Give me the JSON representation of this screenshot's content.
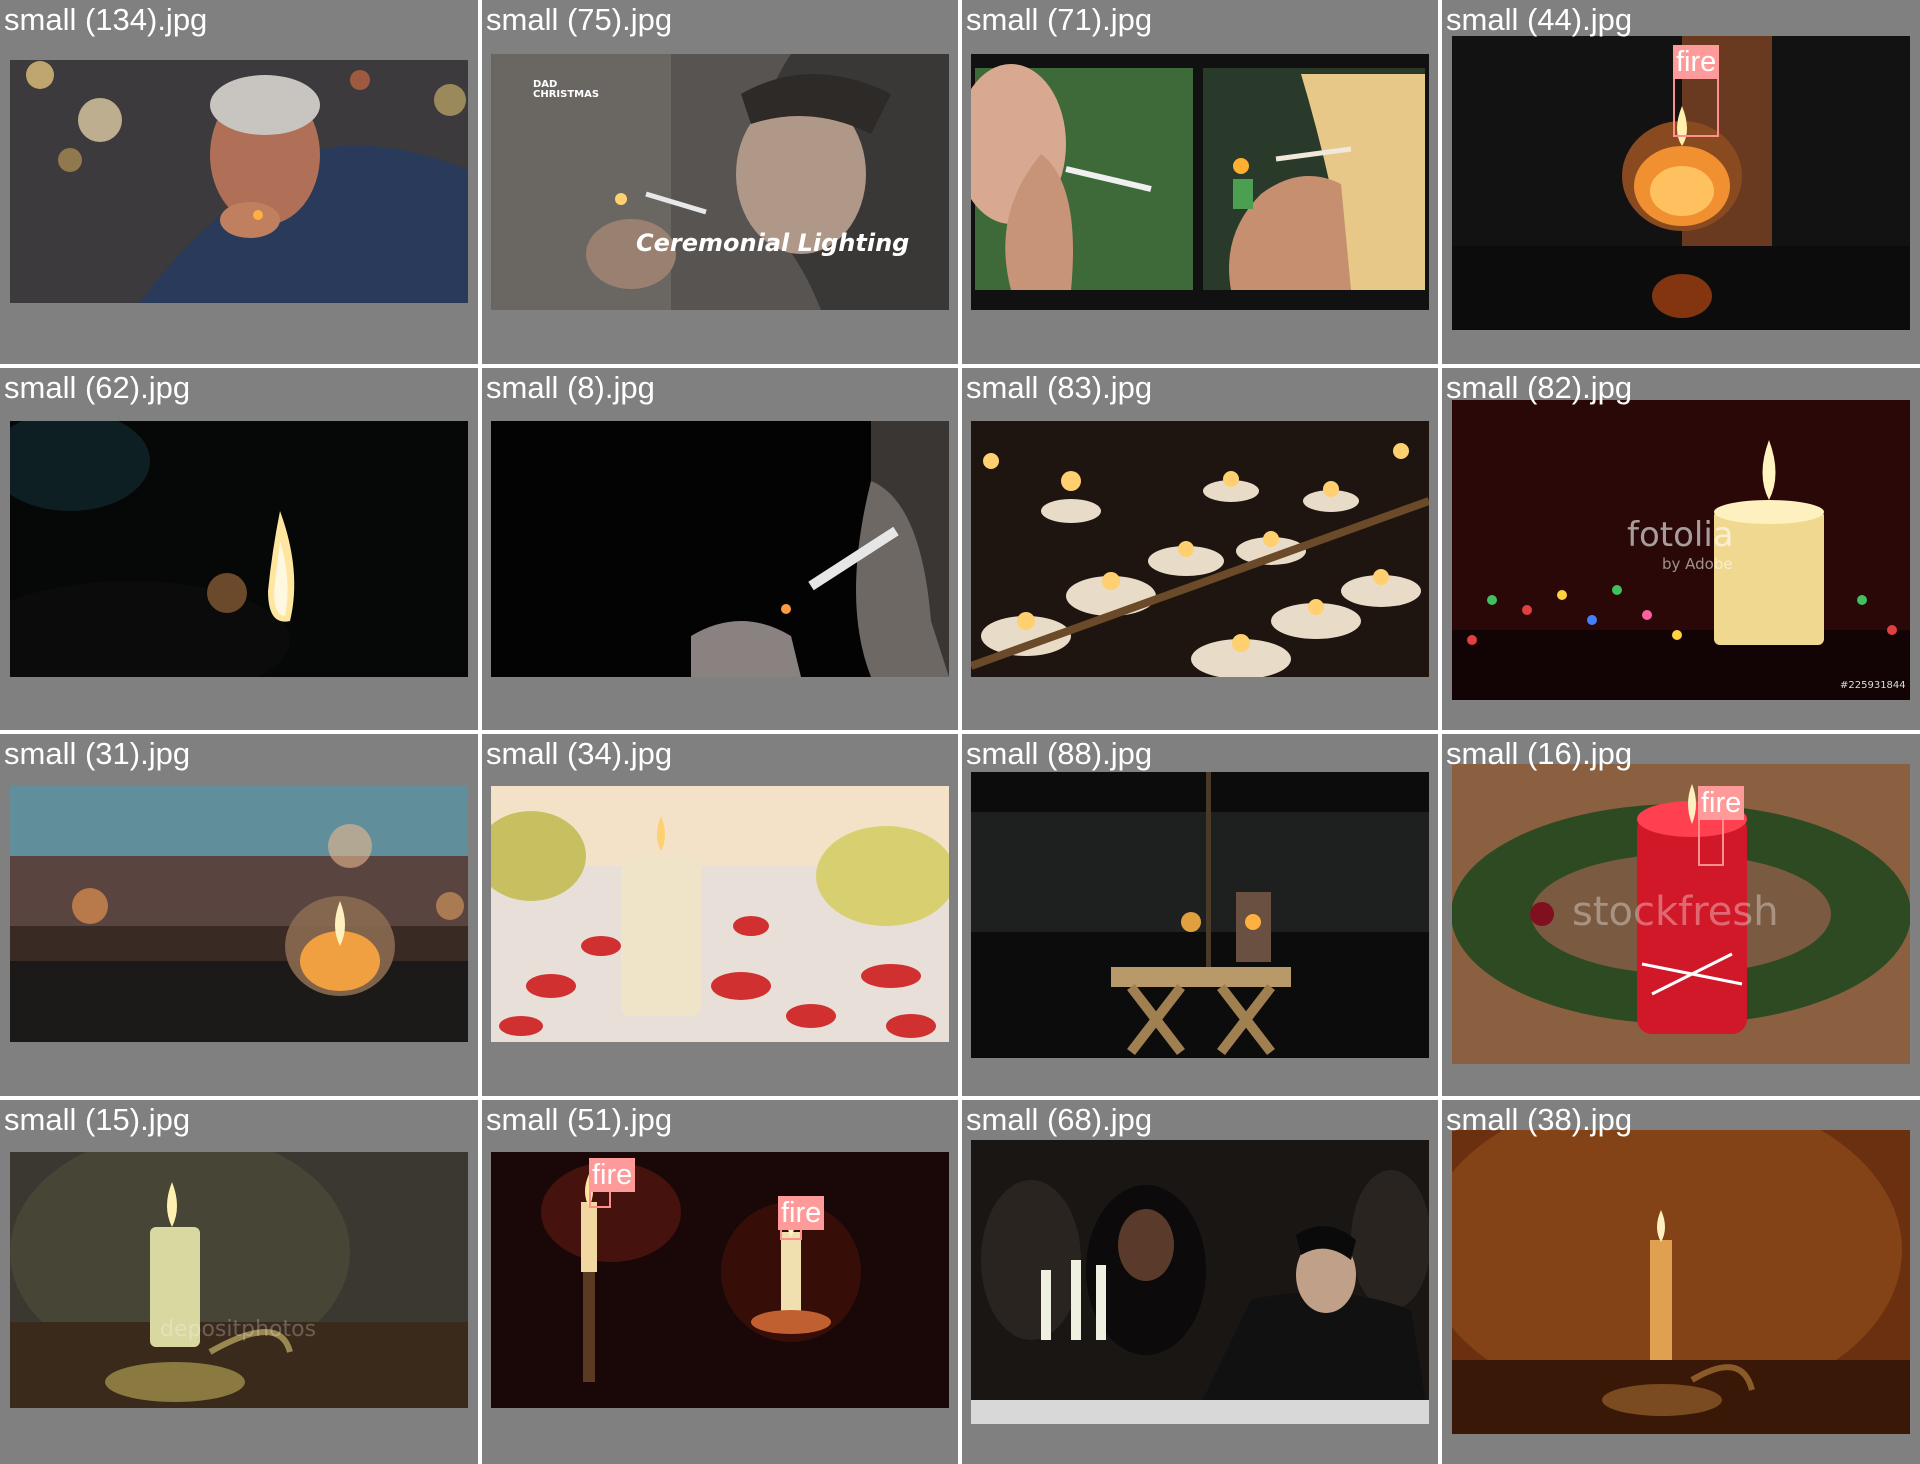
{
  "filenames": [
    "small (134).jpg",
    "small (75).jpg",
    "small (71).jpg",
    "small (44).jpg",
    "small (62).jpg",
    "small (8).jpg",
    "small (83).jpg",
    "small (82).jpg",
    "small (31).jpg",
    "small (34).jpg",
    "small (88).jpg",
    "small (16).jpg",
    "small (15).jpg",
    "small (51).jpg",
    "small (68).jpg",
    "small (38).jpg"
  ],
  "detection_label": "fire",
  "overlays": {
    "nbc_logo": "DAD CHRISTMAS",
    "ceremonial_caption": "Ceremonial Lighting",
    "fotolia_brand": "fotolia",
    "fotolia_sub": "by Adobe",
    "fotolia_id": "#225931844",
    "stockfresh": "stockfresh",
    "depositphotos": "depositphotos"
  },
  "colors": {
    "cell_background": "#808080",
    "grid_lines": "#ffffff",
    "detection_box": "#ff8f8f"
  }
}
